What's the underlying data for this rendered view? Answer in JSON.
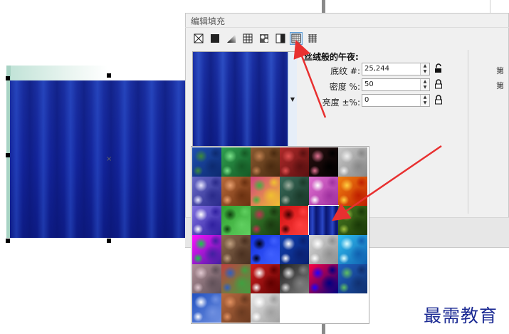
{
  "dialog": {
    "title": "编辑填充",
    "fill_types": [
      {
        "name": "no-fill",
        "active": false
      },
      {
        "name": "uniform-fill",
        "active": false
      },
      {
        "name": "fountain-fill",
        "active": false
      },
      {
        "name": "vector-pattern-fill",
        "active": false
      },
      {
        "name": "bitmap-pattern-fill",
        "active": false
      },
      {
        "name": "two-color-pattern-fill",
        "active": false
      },
      {
        "name": "texture-fill",
        "active": true
      },
      {
        "name": "postscript-fill",
        "active": false
      }
    ],
    "texture_name": "丝绒般的午夜:",
    "fields": [
      {
        "label": "底纹 #:",
        "value": "25,244",
        "lock_icon": "unlock-icon"
      },
      {
        "label": "密度 %:",
        "value": "50",
        "lock_icon": "lock-icon"
      },
      {
        "label": "亮度 ±%:",
        "value": "0",
        "lock_icon": "lock-icon"
      }
    ],
    "edge_labels": [
      "第",
      "第"
    ]
  },
  "texture_picker": {
    "tiles": [
      {
        "name": "tile-blue-cells",
        "colors": [
          "#1e4fb0",
          "#3a8a3a",
          "#0d2a70"
        ]
      },
      {
        "name": "tile-green-blotch",
        "colors": [
          "#2fa050",
          "#7be28a",
          "#155a25"
        ]
      },
      {
        "name": "tile-brown-speckle",
        "colors": [
          "#8a5a30",
          "#c08050",
          "#4a2a10"
        ]
      },
      {
        "name": "tile-red-granite",
        "colors": [
          "#b02a2a",
          "#e05050",
          "#5a1010"
        ]
      },
      {
        "name": "tile-dark-pink-specks",
        "colors": [
          "#2a1010",
          "#e07090",
          "#000000"
        ]
      },
      {
        "name": "tile-gray-stone",
        "colors": [
          "#c8c8c8",
          "#f0f0f0",
          "#888888"
        ]
      },
      {
        "name": "tile-blue-purple-swirl",
        "colors": [
          "#6a6ac8",
          "#e8e8ff",
          "#2a2a8a"
        ]
      },
      {
        "name": "tile-copper-bumps",
        "colors": [
          "#b86a3a",
          "#e8a070",
          "#6a3010"
        ]
      },
      {
        "name": "tile-rainbow-speckle",
        "colors": [
          "#d04080",
          "#40b040",
          "#f0c030"
        ]
      },
      {
        "name": "tile-green-gray-marble",
        "colors": [
          "#3a6a5a",
          "#a0b0a0",
          "#1a3a2a"
        ]
      },
      {
        "name": "tile-pink-white-veins",
        "colors": [
          "#e070d0",
          "#ffffff",
          "#a030a0"
        ]
      },
      {
        "name": "tile-fire-orange",
        "colors": [
          "#f08010",
          "#ffd040",
          "#c02000"
        ]
      },
      {
        "name": "tile-violet-blobs",
        "colors": [
          "#8070e0",
          "#ffffff",
          "#3020a0"
        ]
      },
      {
        "name": "tile-green-moss",
        "colors": [
          "#30a030",
          "#104010",
          "#60d060"
        ]
      },
      {
        "name": "tile-green-red-noise",
        "colors": [
          "#3a8a30",
          "#c03050",
          "#1a3a10"
        ]
      },
      {
        "name": "tile-red-rings",
        "colors": [
          "#d01010",
          "#400000",
          "#ff4040"
        ]
      },
      {
        "name": "tile-velvet-midnight",
        "colors": [
          "#12238e",
          "#2b48c8",
          "#0a1670"
        ]
      },
      {
        "name": "tile-green-leaves",
        "colors": [
          "#4a7a20",
          "#a0c040",
          "#1a3a08"
        ]
      },
      {
        "name": "tile-magenta-green-plasma",
        "colors": [
          "#ff10ff",
          "#10d040",
          "#4020a0"
        ]
      },
      {
        "name": "tile-brown-cracks",
        "colors": [
          "#8a6a50",
          "#c0a080",
          "#4a3020"
        ]
      },
      {
        "name": "tile-blue-black-swirl",
        "colors": [
          "#1030e0",
          "#000010",
          "#4060ff"
        ]
      },
      {
        "name": "tile-blue-white-sparkles",
        "colors": [
          "#1040b0",
          "#ffffff",
          "#0a2070"
        ]
      },
      {
        "name": "tile-white-ripples",
        "colors": [
          "#d8d8d8",
          "#ffffff",
          "#909090"
        ]
      },
      {
        "name": "tile-cyan-caustics",
        "colors": [
          "#30c0f0",
          "#e0ffff",
          "#1060b0"
        ]
      },
      {
        "name": "tile-pink-gray-stucco",
        "colors": [
          "#b09098",
          "#e0c8d0",
          "#605058"
        ]
      },
      {
        "name": "tile-multicolor-confetti",
        "colors": [
          "#c04040",
          "#3060c0",
          "#40a040"
        ]
      },
      {
        "name": "tile-red-white-mosaic",
        "colors": [
          "#d02020",
          "#ffffff",
          "#600000"
        ]
      },
      {
        "name": "tile-black-white-marble",
        "colors": [
          "#202020",
          "#e0e0e0",
          "#808080"
        ]
      },
      {
        "name": "tile-red-blue-gradient",
        "colors": [
          "#ff0040",
          "#2000ff",
          "#000080"
        ]
      },
      {
        "name": "tile-blue-green-foam",
        "colors": [
          "#2060c0",
          "#60c060",
          "#103070"
        ]
      },
      {
        "name": "tile-blue-white-clouds",
        "colors": [
          "#2050c0",
          "#ffffff",
          "#7090e0"
        ]
      },
      {
        "name": "tile-terracotta",
        "colors": [
          "#b86a40",
          "#e09060",
          "#6a3a20"
        ]
      },
      {
        "name": "tile-white-dots",
        "colors": [
          "#e8e8e8",
          "#ffffff",
          "#a0a0a0"
        ]
      }
    ]
  },
  "watermark": "最需教育",
  "annotation_color": "#e83030"
}
